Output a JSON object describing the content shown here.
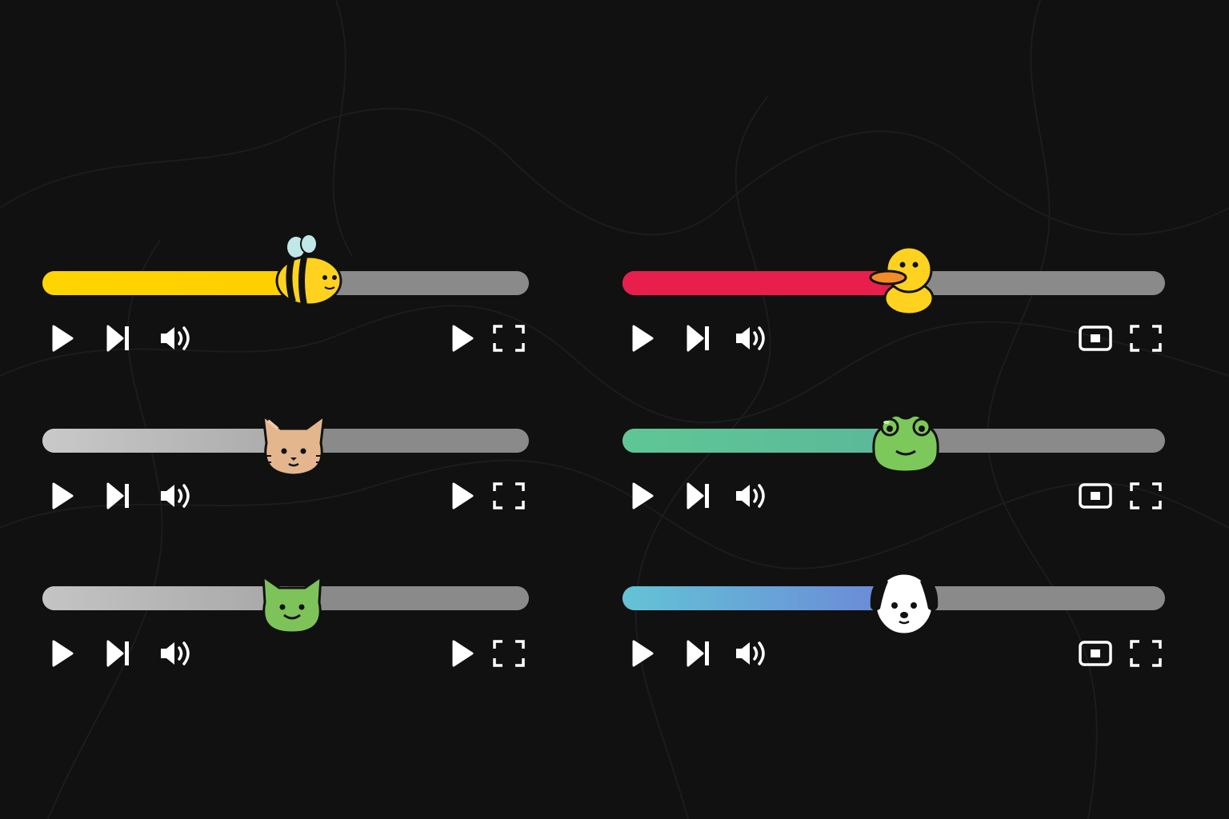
{
  "theme": {
    "background": "#111111",
    "track_color": "#8a8a8a",
    "icon_color": "#ffffff"
  },
  "players": [
    {
      "id": "bee",
      "thumb_icon": "bee-icon",
      "progress": 0.53,
      "fill": {
        "from": "#ffd400",
        "to": "#ffcf00"
      },
      "controls": [
        "play-icon",
        "skip-next-icon",
        "volume-icon",
        "play-icon",
        "fullscreen-icon"
      ]
    },
    {
      "id": "duck",
      "thumb_icon": "duck-icon",
      "progress": 0.5,
      "fill": {
        "from": "#e81e4d",
        "to": "#e81e4d"
      },
      "controls": [
        "play-icon",
        "skip-next-icon",
        "volume-icon",
        "miniplayer-icon",
        "fullscreen-icon"
      ]
    },
    {
      "id": "cat",
      "thumb_icon": "cat-icon",
      "progress": 0.52,
      "fill": {
        "from": "#c9c9c9",
        "to": "#a9a9a9"
      },
      "controls": [
        "play-icon",
        "skip-next-icon",
        "volume-icon",
        "play-icon",
        "fullscreen-icon"
      ]
    },
    {
      "id": "frog",
      "thumb_icon": "frog-icon",
      "progress": 0.52,
      "fill": {
        "from": "#5ec795",
        "to": "#5bb89a"
      },
      "controls": [
        "play-icon",
        "skip-next-icon",
        "volume-icon",
        "miniplayer-icon",
        "fullscreen-icon"
      ]
    },
    {
      "id": "green-cat",
      "thumb_icon": "green-cat-icon",
      "progress": 0.52,
      "fill": {
        "from": "#c4c4c4",
        "to": "#a6a6a6"
      },
      "controls": [
        "play-icon",
        "skip-next-icon",
        "volume-icon",
        "play-icon",
        "fullscreen-icon"
      ]
    },
    {
      "id": "dog",
      "thumb_icon": "dog-icon",
      "progress": 0.52,
      "fill": {
        "from": "#63c3d6",
        "to": "#6c86d8"
      },
      "controls": [
        "play-icon",
        "skip-next-icon",
        "volume-icon",
        "miniplayer-icon",
        "fullscreen-icon"
      ]
    }
  ]
}
